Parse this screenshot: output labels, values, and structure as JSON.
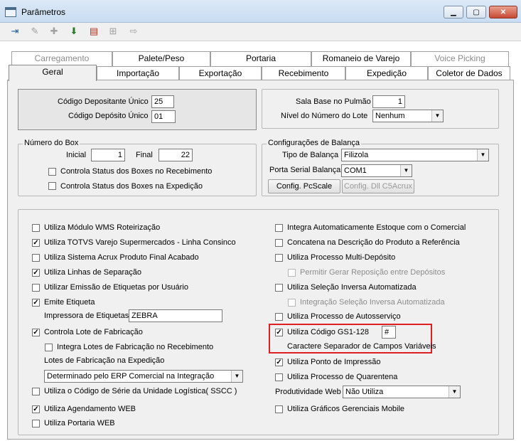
{
  "window": {
    "title": "Parâmetros"
  },
  "toolbar": {
    "icons": [
      "exit-icon",
      "eraser-icon",
      "add-record-icon",
      "save-download-icon",
      "delete-record-icon",
      "move-right-icon",
      "export-arrow-icon"
    ]
  },
  "tabs_row1": [
    "Carregamento",
    "Palete/Peso",
    "Portaria",
    "Romaneio de Varejo",
    "Voice Picking"
  ],
  "tabs_row2": [
    "Geral",
    "Importação",
    "Exportação",
    "Recebimento",
    "Expedição",
    "Coletor de Dados"
  ],
  "top_left": {
    "deposit_unique_label": "Código Depositante Único",
    "deposit_unique_value": "25",
    "depot_unique_label": "Código Depósito Único",
    "depot_unique_value": "01"
  },
  "top_right": {
    "sala_label": "Sala Base no Pulmão",
    "sala_value": "1",
    "nivel_label": "Nível do Número do Lote",
    "nivel_value": "Nenhum"
  },
  "box": {
    "title": "Número do Box",
    "initial_label": "Inicial",
    "initial_value": "1",
    "final_label": "Final",
    "final_value": "22",
    "chk_receiving": "Controla Status dos Boxes no Recebimento",
    "chk_shipping": "Controla Status dos Boxes na Expedição"
  },
  "scale": {
    "title": "Configurações de Balança",
    "type_label": "Tipo de Balança",
    "type_value": "Filizola",
    "port_label": "Porta Serial Balança",
    "port_value": "COM1",
    "btn_pcscale": "Config. PcScale",
    "btn_dll": "Config. Dll C5Acrux"
  },
  "left_options": {
    "wms_routing": "Utiliza Módulo WMS Roteirização",
    "totvs": "Utiliza TOTVS Varejo Supermercados - Linha Consinco",
    "acrux": "Utiliza Sistema Acrux Produto Final Acabado",
    "separation": "Utiliza Linhas de Separação",
    "labels_user": "Utilizar Emissão de Etiquetas por Usuário",
    "emit_label": "Emite Etiqueta",
    "printer_label": "Impressora de Etiquetas",
    "printer_value": "ZEBRA",
    "lot_control": "Controla Lote de Fabricação",
    "lot_integrate": "Integra  Lotes de Fabricação no Recebimento",
    "lot_shipping_label": "Lotes de Fabricação na Expedição",
    "lot_shipping_value": "Determinado pelo ERP Comercial na Integração",
    "sscc": "Utiliza o Código de Série da Unidade Logística( SSCC )",
    "web_schedule": "Utiliza Agendamento WEB",
    "web_gate": "Utiliza Portaria WEB"
  },
  "right_options": {
    "auto_stock": "Integra Automaticamente Estoque com o Comercial",
    "concat_desc": "Concatena na Descrição do Produto a Referência",
    "multi_depot": "Utiliza Processo Multi-Depósito",
    "replenish": "Permitir Gerar Reposição entre Depósitos",
    "inverse_sel": "Utiliza Seleção Inversa Automatizada",
    "inverse_int": "Integração Seleção Inversa Automatizada",
    "self_service": "Utiliza Processo de Autosserviço",
    "gs1": "Utiliza Código GS1-128",
    "gs1_sep_value": "#",
    "gs1_sep_label": "Caractere Separador de Campos Variáveis",
    "print_point": "Utiliza Ponto de Impressão",
    "quarantine": "Utiliza Processo de Quarentena",
    "productivity_label": "Produtividade Web",
    "productivity_value": "Não Utiliza",
    "mobile_charts": "Utiliza Gráficos Gerenciais Mobile"
  },
  "check_mark": "✓",
  "arrow_glyph": "▼",
  "colors": {
    "highlight_border": "#e02020",
    "panel_bg": "#f0f0f0"
  }
}
